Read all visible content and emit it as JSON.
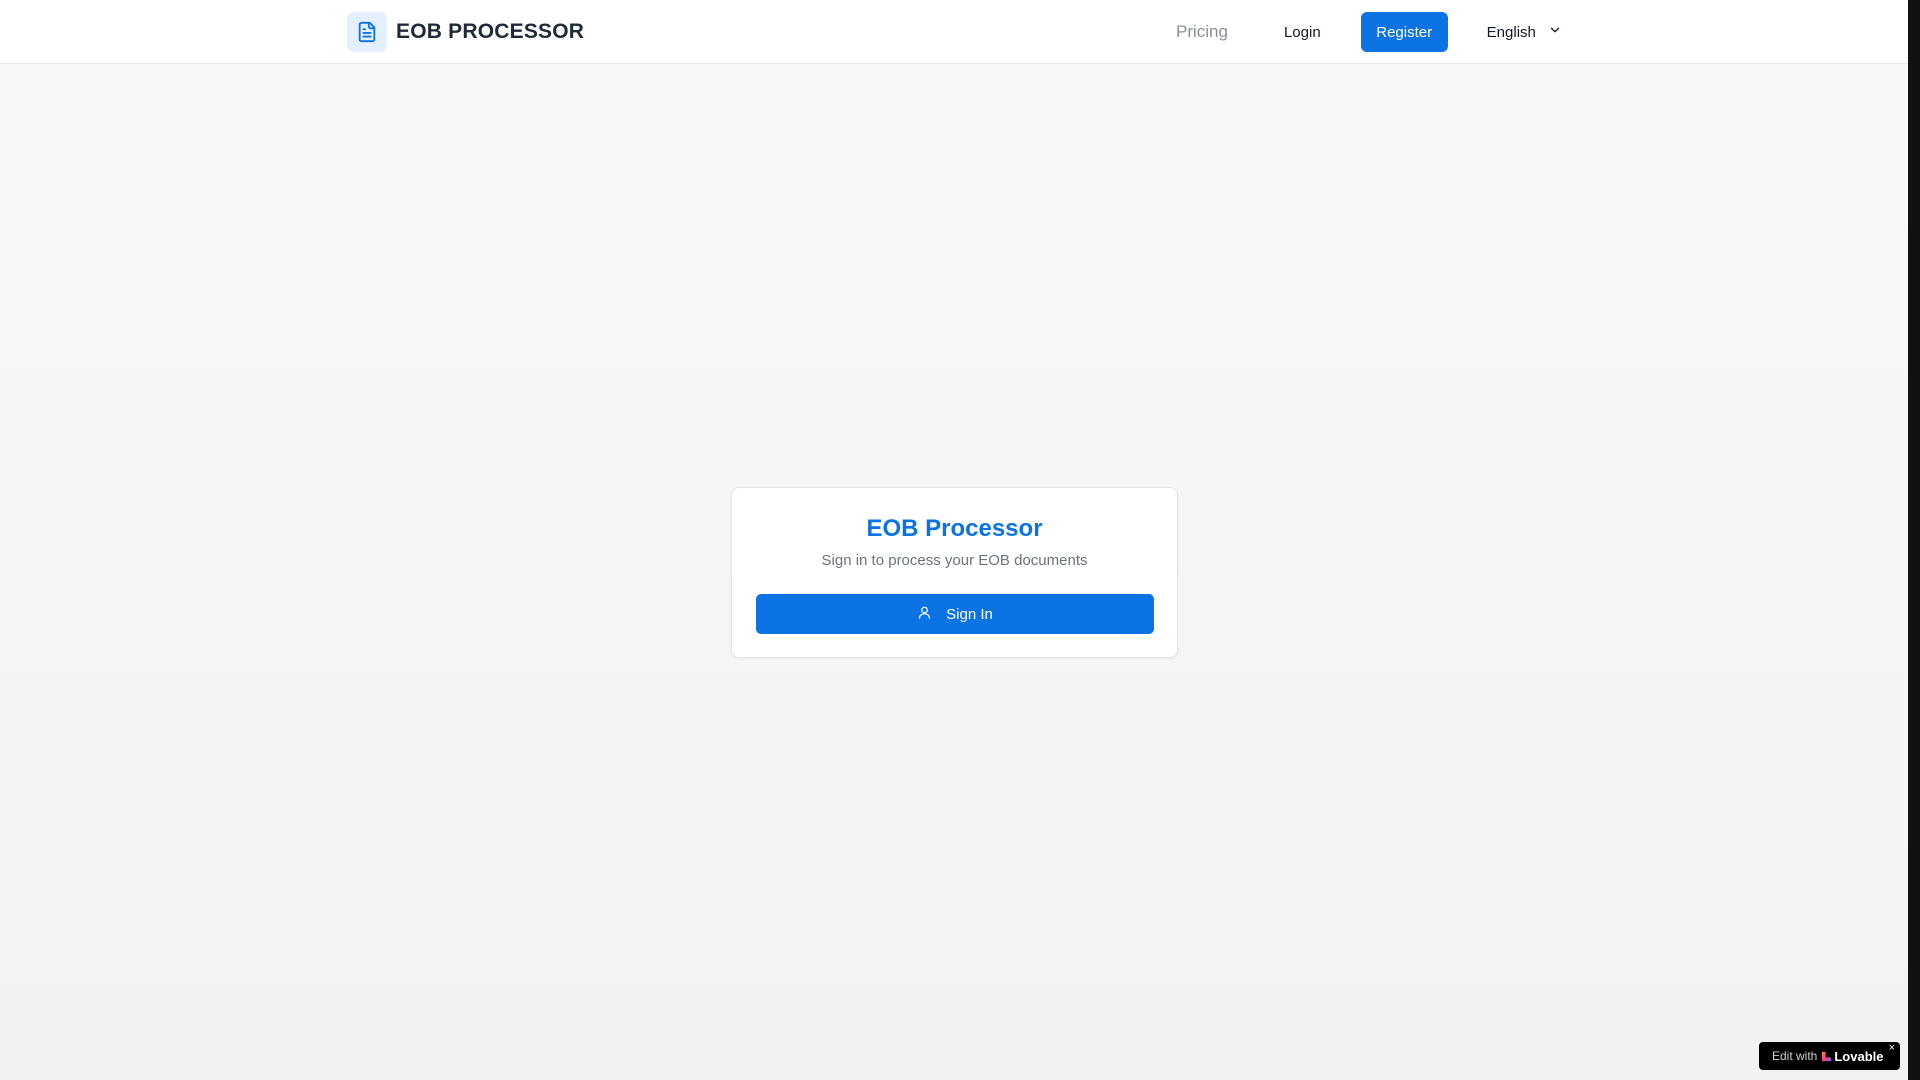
{
  "header": {
    "brand": {
      "icon": "document-icon",
      "title": "EOB PROCESSOR"
    },
    "nav": {
      "pricing_label": "Pricing",
      "login_label": "Login",
      "register_label": "Register",
      "language": {
        "selected": "English",
        "icon": "chevron-down-icon"
      }
    }
  },
  "signin_card": {
    "title": "EOB Processor",
    "subtitle": "Sign in to process your EOB documents",
    "button": {
      "icon": "user-icon",
      "label": "Sign In"
    }
  },
  "lovable_badge": {
    "prefix": "Edit with",
    "brand": "Lovable",
    "close": "×"
  },
  "colors": {
    "accent": "#0b73e3",
    "brand_icon_bg": "#e4efff",
    "page_background": "#f5f6f8",
    "muted_text": "#6b7280"
  }
}
